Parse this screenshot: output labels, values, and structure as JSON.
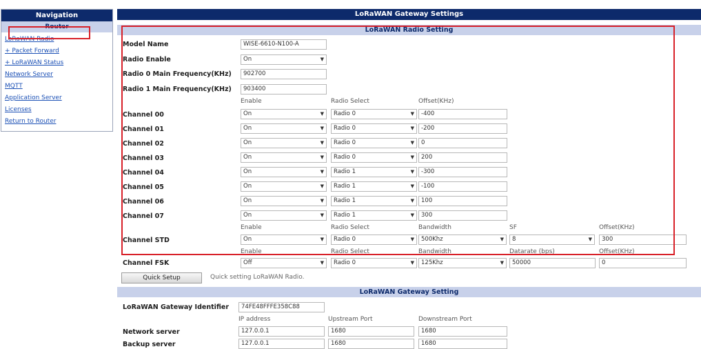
{
  "nav": {
    "title": "Navigation",
    "router": "Router",
    "links": [
      "LoRaWAN Radio",
      "+ Packet Forward",
      "+ LoRaWAN Status",
      "Network Server",
      "MQTT",
      "Application Server",
      "Licenses",
      "Return to Router"
    ]
  },
  "page_title": "LoRaWAN Gateway Settings",
  "radio": {
    "section_title": "LoRaWAN Radio Setting",
    "model_label": "Model Name",
    "model_value": "WISE-6610-N100-A",
    "enable_label": "Radio Enable",
    "enable_value": "On",
    "freq0_label": "Radio 0 Main Frequency(KHz)",
    "freq0_value": "902700",
    "freq1_label": "Radio 1 Main Frequency(KHz)",
    "freq1_value": "903400",
    "headers": {
      "enable": "Enable",
      "radio": "Radio Select",
      "offset": "Offset(KHz)"
    },
    "channels": [
      {
        "label": "Channel 00",
        "enable": "On",
        "radio": "Radio 0",
        "offset": "-400"
      },
      {
        "label": "Channel 01",
        "enable": "On",
        "radio": "Radio 0",
        "offset": "-200"
      },
      {
        "label": "Channel 02",
        "enable": "On",
        "radio": "Radio 0",
        "offset": "0"
      },
      {
        "label": "Channel 03",
        "enable": "On",
        "radio": "Radio 0",
        "offset": "200"
      },
      {
        "label": "Channel 04",
        "enable": "On",
        "radio": "Radio 1",
        "offset": "-300"
      },
      {
        "label": "Channel 05",
        "enable": "On",
        "radio": "Radio 1",
        "offset": "-100"
      },
      {
        "label": "Channel 06",
        "enable": "On",
        "radio": "Radio 1",
        "offset": "100"
      },
      {
        "label": "Channel 07",
        "enable": "On",
        "radio": "Radio 1",
        "offset": "300"
      }
    ],
    "std": {
      "headers": {
        "enable": "Enable",
        "radio": "Radio Select",
        "bandwidth": "Bandwidth",
        "sf": "SF",
        "offset": "Offset(KHz)"
      },
      "label": "Channel STD",
      "enable": "On",
      "radio": "Radio 0",
      "bandwidth": "500Khz",
      "sf": "8",
      "offset": "300"
    },
    "fsk": {
      "headers": {
        "enable": "Enable",
        "radio": "Radio Select",
        "bandwidth": "Bandwidth",
        "datarate": "Datarate (bps)",
        "offset": "Offset(KHz)"
      },
      "label": "Channel FSK",
      "enable": "Off",
      "radio": "Radio 0",
      "bandwidth": "125Khz",
      "datarate": "50000",
      "offset": "0"
    },
    "quick_setup_button": "Quick Setup",
    "quick_setup_hint": "Quick setting LoRaWAN Radio."
  },
  "gateway": {
    "section_title": "LoRaWAN Gateway Setting",
    "id_label": "LoRaWAN Gateway Identifier",
    "id_value": "74FE48FFFE358C88",
    "headers": {
      "ip": "IP address",
      "up": "Upstream Port",
      "down": "Downstream Port"
    },
    "network": {
      "label": "Network server",
      "ip": "127.0.0.1",
      "up": "1680",
      "down": "1680"
    },
    "backup": {
      "label": "Backup server",
      "ip": "127.0.0.1",
      "up": "1680",
      "down": "1680"
    }
  },
  "colors": {
    "nav_header": "#0d2a6b",
    "section_header": "#c8d1ea",
    "link": "#1a4fb5",
    "highlight": "#d82028"
  }
}
